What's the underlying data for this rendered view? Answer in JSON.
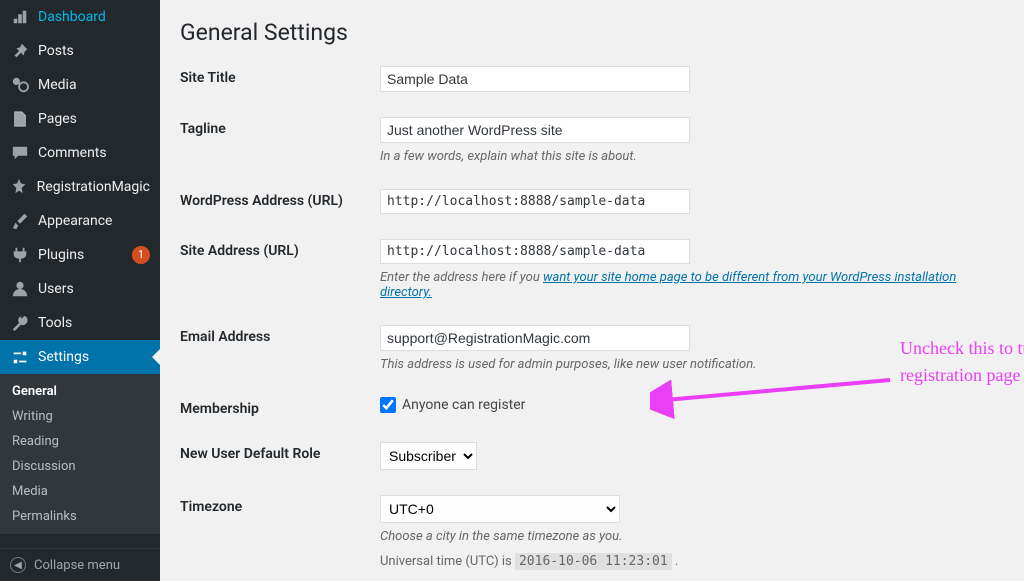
{
  "sidebar": {
    "items": [
      {
        "icon": "dashboard",
        "label": "Dashboard"
      },
      {
        "icon": "pin",
        "label": "Posts"
      },
      {
        "icon": "media",
        "label": "Media"
      },
      {
        "icon": "page",
        "label": "Pages"
      },
      {
        "icon": "comment",
        "label": "Comments"
      },
      {
        "icon": "magic",
        "label": "RegistrationMagic"
      },
      {
        "icon": "brush",
        "label": "Appearance"
      },
      {
        "icon": "plug",
        "label": "Plugins",
        "badge": "1"
      },
      {
        "icon": "user",
        "label": "Users"
      },
      {
        "icon": "wrench",
        "label": "Tools"
      },
      {
        "icon": "sliders",
        "label": "Settings",
        "active": true
      }
    ],
    "submenu": [
      "General",
      "Writing",
      "Reading",
      "Discussion",
      "Media",
      "Permalinks"
    ],
    "submenu_current": 0,
    "collapse": "Collapse menu"
  },
  "page": {
    "title": "General Settings",
    "fields": {
      "site_title": {
        "label": "Site Title",
        "value": "Sample Data"
      },
      "tagline": {
        "label": "Tagline",
        "value": "Just another WordPress site",
        "desc": "In a few words, explain what this site is about."
      },
      "wp_url": {
        "label": "WordPress Address (URL)",
        "value": "http://localhost:8888/sample-data"
      },
      "site_url": {
        "label": "Site Address (URL)",
        "value": "http://localhost:8888/sample-data",
        "desc_pre": "Enter the address here if you ",
        "desc_link": "want your site home page to be different from your WordPress installation directory."
      },
      "email": {
        "label": "Email Address",
        "value": "support@RegistrationMagic.com",
        "desc": "This address is used for admin purposes, like new user notification."
      },
      "membership": {
        "label": "Membership",
        "checkbox_label": "Anyone can register",
        "checked": true
      },
      "default_role": {
        "label": "New User Default Role",
        "value": "Subscriber"
      },
      "timezone": {
        "label": "Timezone",
        "value": "UTC+0",
        "desc": "Choose a city in the same timezone as you.",
        "utc_pre": "Universal time (UTC) is ",
        "utc_code": "2016-10-06 11:23:01",
        "utc_post": " ."
      }
    }
  },
  "annotation": "Uncheck this to turn off default registration page"
}
